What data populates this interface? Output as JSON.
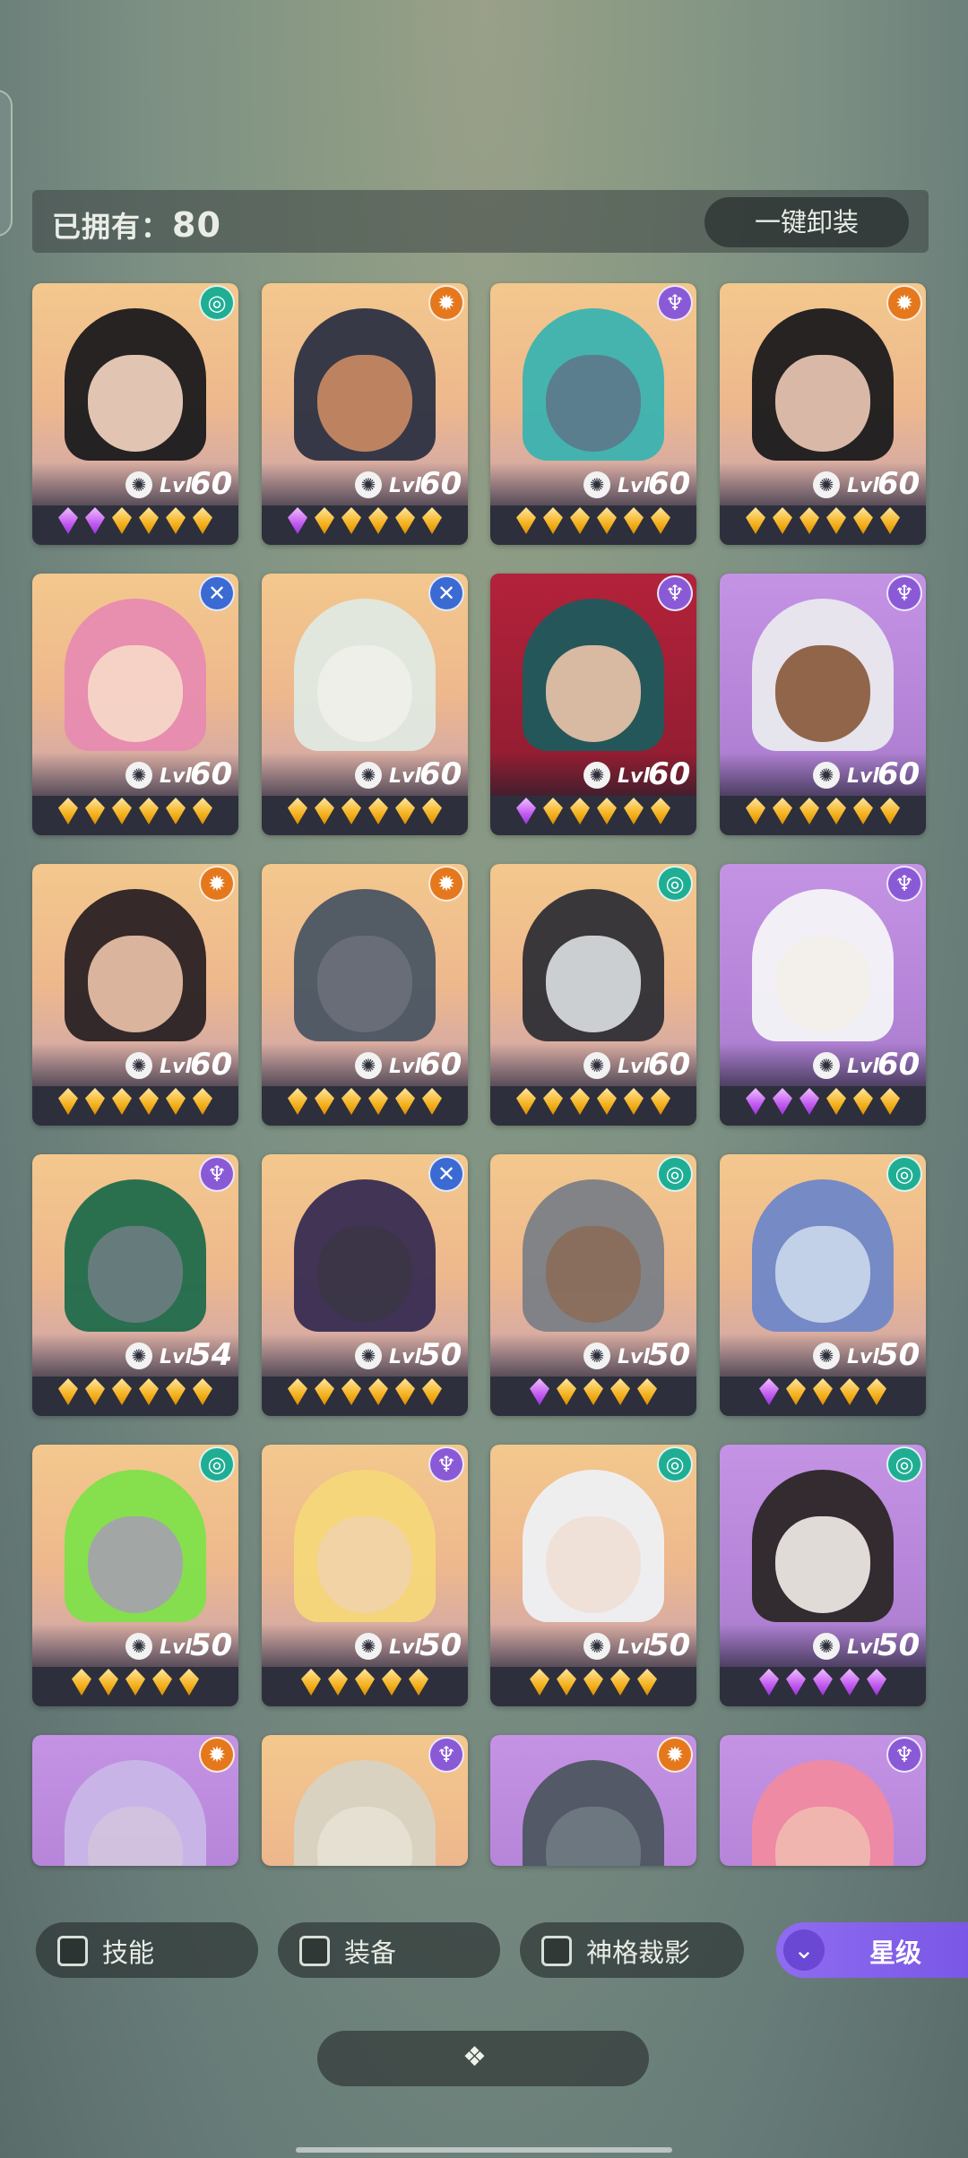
{
  "header": {
    "owned_label": "已拥有：",
    "owned_count": "80",
    "unequip_all": "一键卸装"
  },
  "level_prefix": "Lvl",
  "gear_glyph": "✺",
  "cards": [
    {
      "level": "60",
      "class_icon": "spiral-icon",
      "class_color": "#1fae94",
      "bg": "warm",
      "stars": [
        "purple",
        "purple",
        "gold",
        "gold",
        "gold",
        "gold"
      ]
    },
    {
      "level": "60",
      "class_icon": "sun-icon",
      "class_color": "#e5781d",
      "bg": "warm",
      "stars": [
        "purple",
        "gold",
        "gold",
        "gold",
        "gold",
        "gold"
      ]
    },
    {
      "level": "60",
      "class_icon": "lotus-icon",
      "class_color": "#8a5ad6",
      "bg": "warm",
      "stars": [
        "gold",
        "gold",
        "gold",
        "gold",
        "gold",
        "gold"
      ]
    },
    {
      "level": "60",
      "class_icon": "sun-icon",
      "class_color": "#e5781d",
      "bg": "warm",
      "stars": [
        "gold",
        "gold",
        "gold",
        "gold",
        "gold",
        "gold"
      ]
    },
    {
      "level": "60",
      "class_icon": "cross-icon",
      "class_color": "#3c6ad3",
      "bg": "warm",
      "stars": [
        "gold",
        "gold",
        "gold",
        "gold",
        "gold",
        "gold"
      ]
    },
    {
      "level": "60",
      "class_icon": "cross-icon",
      "class_color": "#3c6ad3",
      "bg": "warm",
      "stars": [
        "gold",
        "gold",
        "gold",
        "gold",
        "gold",
        "gold"
      ]
    },
    {
      "level": "60",
      "class_icon": "lotus-icon",
      "class_color": "#8a5ad6",
      "bg": "red",
      "stars": [
        "purple",
        "gold",
        "gold",
        "gold",
        "gold",
        "gold"
      ]
    },
    {
      "level": "60",
      "class_icon": "lotus-icon",
      "class_color": "#8a5ad6",
      "bg": "purple",
      "stars": [
        "gold",
        "gold",
        "gold",
        "gold",
        "gold",
        "gold"
      ]
    },
    {
      "level": "60",
      "class_icon": "sun-icon",
      "class_color": "#e5781d",
      "bg": "warm",
      "stars": [
        "gold",
        "gold",
        "gold",
        "gold",
        "gold",
        "gold"
      ]
    },
    {
      "level": "60",
      "class_icon": "sun-icon",
      "class_color": "#e5781d",
      "bg": "warm",
      "stars": [
        "gold",
        "gold",
        "gold",
        "gold",
        "gold",
        "gold"
      ]
    },
    {
      "level": "60",
      "class_icon": "spiral-icon",
      "class_color": "#1fae94",
      "bg": "warm",
      "stars": [
        "gold",
        "gold",
        "gold",
        "gold",
        "gold",
        "gold"
      ]
    },
    {
      "level": "60",
      "class_icon": "lotus-icon",
      "class_color": "#8a5ad6",
      "bg": "purple",
      "stars": [
        "purple",
        "purple",
        "purple",
        "gold",
        "gold",
        "gold"
      ]
    },
    {
      "level": "54",
      "class_icon": "lotus-icon",
      "class_color": "#8a5ad6",
      "bg": "warm",
      "stars": [
        "gold",
        "gold",
        "gold",
        "gold",
        "gold",
        "gold"
      ]
    },
    {
      "level": "50",
      "class_icon": "cross-icon",
      "class_color": "#3c6ad3",
      "bg": "warm",
      "stars": [
        "gold",
        "gold",
        "gold",
        "gold",
        "gold",
        "gold"
      ]
    },
    {
      "level": "50",
      "class_icon": "spiral-icon",
      "class_color": "#1fae94",
      "bg": "warm",
      "stars": [
        "purple",
        "gold",
        "gold",
        "gold",
        "gold"
      ]
    },
    {
      "level": "50",
      "class_icon": "spiral-icon",
      "class_color": "#1fae94",
      "bg": "warm",
      "stars": [
        "purple",
        "gold",
        "gold",
        "gold",
        "gold"
      ]
    },
    {
      "level": "50",
      "class_icon": "spiral-icon",
      "class_color": "#1fae94",
      "bg": "warm",
      "stars": [
        "gold",
        "gold",
        "gold",
        "gold",
        "gold"
      ]
    },
    {
      "level": "50",
      "class_icon": "lotus-icon",
      "class_color": "#8a5ad6",
      "bg": "warm",
      "stars": [
        "gold",
        "gold",
        "gold",
        "gold",
        "gold"
      ]
    },
    {
      "level": "50",
      "class_icon": "spiral-icon",
      "class_color": "#1fae94",
      "bg": "warm",
      "stars": [
        "gold",
        "gold",
        "gold",
        "gold",
        "gold"
      ]
    },
    {
      "level": "50",
      "class_icon": "spiral-icon",
      "class_color": "#1fae94",
      "bg": "purple",
      "stars": [
        "purple",
        "purple",
        "purple",
        "purple",
        "purple"
      ]
    },
    {
      "level": "",
      "class_icon": "sun-icon",
      "class_color": "#e5781d",
      "bg": "purple",
      "stars": []
    },
    {
      "level": "",
      "class_icon": "lotus-icon",
      "class_color": "#8a5ad6",
      "bg": "warm",
      "stars": []
    },
    {
      "level": "",
      "class_icon": "sun-icon",
      "class_color": "#e5781d",
      "bg": "purple",
      "stars": []
    },
    {
      "level": "",
      "class_icon": "lotus-icon",
      "class_color": "#8a5ad6",
      "bg": "purple",
      "stars": []
    }
  ],
  "filters": {
    "skill": "技能",
    "equipment": "装备",
    "divinity_shadow": "神格裁影",
    "sort_label": "星级"
  },
  "icon_glyphs": {
    "spiral-icon": "◎",
    "sun-icon": "✹",
    "lotus-icon": "♆",
    "cross-icon": "✕",
    "sort-chevron-icon": "⌄",
    "expand-icon": "❖"
  }
}
